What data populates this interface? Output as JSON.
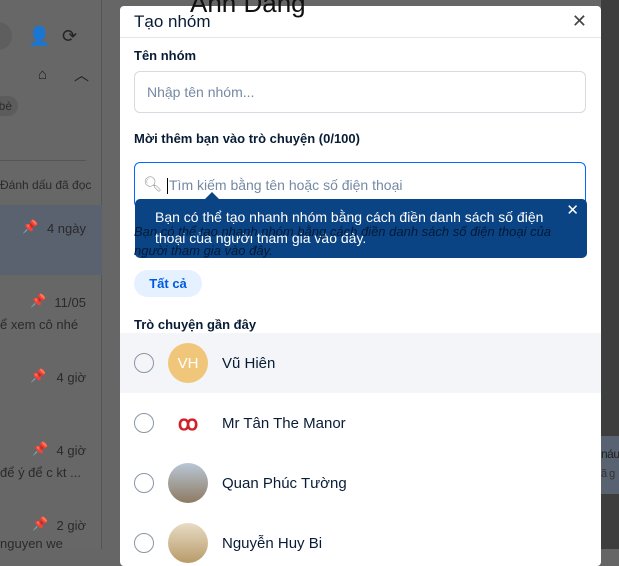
{
  "background": {
    "header_name": "Anh Dang",
    "filter_chip": "bè",
    "mark_read": "Đánh dấu đã đọc",
    "conversations": [
      {
        "time": "4 ngày",
        "preview": ""
      },
      {
        "time": "11/05",
        "preview": "ể xem cô nhé"
      },
      {
        "time": "4 giờ",
        "preview": ""
      },
      {
        "time": "4 giờ",
        "preview": "để ý để c kt ..."
      },
      {
        "time": "2 giờ",
        "preview": "nguyen we"
      }
    ],
    "right_peek": [
      "náu",
      "ã g"
    ]
  },
  "modal": {
    "title": "Tạo nhóm",
    "group_name_label": "Tên nhóm",
    "group_name_placeholder": "Nhập tên nhóm...",
    "invite_label": "Mời thêm bạn vào trò chuyện (0/100)",
    "search_placeholder": "Tìm kiếm bằng tên hoặc số điện thoại",
    "hint": "Bạn có thể tạo nhanh nhóm bằng cách điền danh sách số điện thoại của người tham gia vào đây.",
    "tooltip": "Bạn có thể tạo nhanh nhóm bằng cách điền danh sách số điện thoại của người tham gia vào đây.",
    "filter_all": "Tất cả",
    "recent_label": "Trò chuyện gần đây",
    "contacts": [
      {
        "name": "Vũ Hiên",
        "initials": "VH",
        "color": "#f0c77a"
      },
      {
        "name": "Mr Tân The Manor",
        "initials": "",
        "color": "#ffffff"
      },
      {
        "name": "Quan Phúc Tường",
        "initials": "",
        "color": "#c9b9a3"
      },
      {
        "name": "Nguyễn Huy Bi",
        "initials": "",
        "color": "#d9cbb0"
      }
    ]
  }
}
